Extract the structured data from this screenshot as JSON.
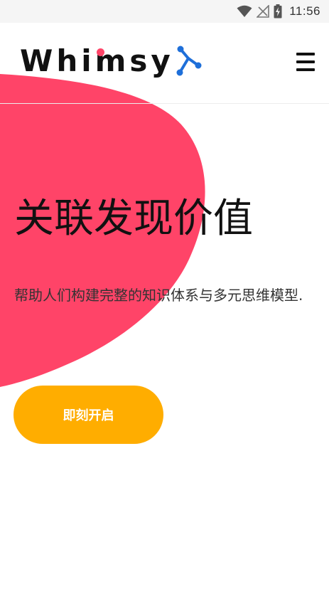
{
  "status_bar": {
    "time": "11:56",
    "icons": [
      "wifi-icon",
      "no-signal-icon",
      "battery-charging-icon"
    ]
  },
  "app": {
    "logo_text": "Whimsy",
    "logo_mark_icon": "network-node-icon",
    "menu_icon": "hamburger-menu-icon"
  },
  "hero": {
    "title": "关联发现价值",
    "description": "帮助人们构建完整的知识体系与多元思维模型.",
    "cta_label": "即刻开启"
  },
  "colors": {
    "blob": "#ff4468",
    "cta": "#ffad00",
    "accent": "#1e6fd9",
    "text": "#111111"
  }
}
